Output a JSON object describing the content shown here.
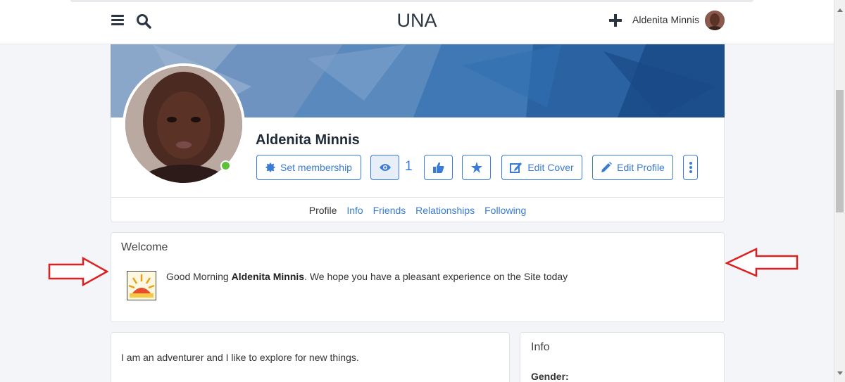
{
  "header": {
    "logo": "UNA",
    "user_name": "Aldenita Minnis"
  },
  "profile": {
    "name": "Aldenita Minnis",
    "views_count": "1",
    "buttons": {
      "set_membership": "Set membership",
      "edit_cover": "Edit Cover",
      "edit_profile": "Edit Profile"
    },
    "nav": [
      "Profile",
      "Info",
      "Friends",
      "Relationships",
      "Following"
    ]
  },
  "welcome": {
    "title": "Welcome",
    "greeting_prefix": "Good Morning ",
    "greeting_name": "Aldenita Minnis",
    "greeting_suffix": ". We hope you have a pleasant experience on the Site today"
  },
  "about": {
    "text": "I am an adventurer and I like to explore for new things."
  },
  "info": {
    "title": "Info",
    "gender_label": "Gender:"
  },
  "colors": {
    "accent": "#3a7bd5",
    "arrow": "#e02020",
    "online": "#5ec13c"
  }
}
